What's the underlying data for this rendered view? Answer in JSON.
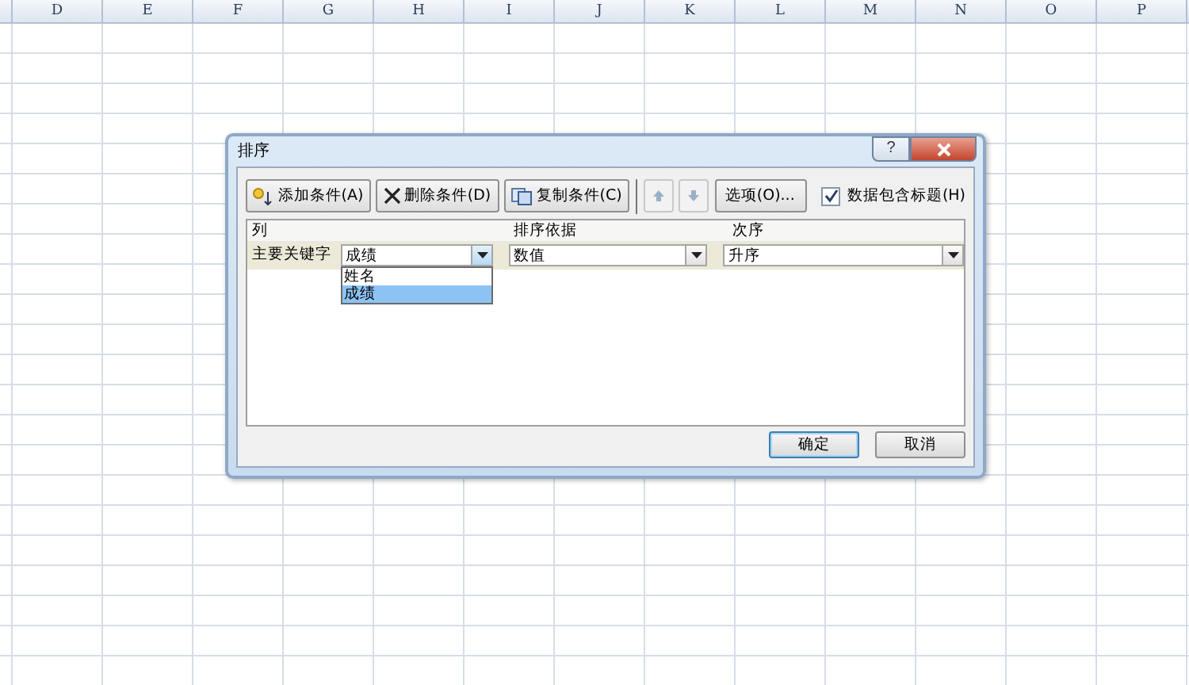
{
  "sheet": {
    "columns": [
      {
        "label": "D"
      },
      {
        "label": "E"
      },
      {
        "label": "F"
      },
      {
        "label": "G"
      },
      {
        "label": "H"
      },
      {
        "label": "I"
      },
      {
        "label": "J"
      },
      {
        "label": "K"
      },
      {
        "label": "L"
      },
      {
        "label": "M"
      },
      {
        "label": "N"
      },
      {
        "label": "O"
      },
      {
        "label": "P"
      }
    ]
  },
  "dialog": {
    "title": "排序",
    "title_buttons": [
      {
        "kind": "help",
        "label": "?"
      },
      {
        "kind": "close"
      }
    ],
    "toolbar": [
      {
        "kind": "add",
        "label": "添加条件(A)",
        "disabled": false
      },
      {
        "kind": "delete",
        "label": "删除条件(D)",
        "disabled": false
      },
      {
        "kind": "copy",
        "label": "复制条件(C)",
        "disabled": false
      },
      {
        "kind": "up",
        "disabled": true
      },
      {
        "kind": "down",
        "disabled": true
      },
      {
        "kind": "text",
        "label": "选项(O)...",
        "disabled": false
      }
    ],
    "header_checkbox": {
      "label": "数据包含标题(H)",
      "checked": true
    },
    "headers": [
      "列",
      "排序依据",
      "次序"
    ],
    "rows": [
      {
        "label": "主要关键字",
        "column": "成绩",
        "sort_on": "数值",
        "order": "升序"
      }
    ],
    "dropdown": {
      "expanded": true,
      "options": [
        {
          "label": "姓名",
          "selected": false
        },
        {
          "label": "成绩",
          "selected": true
        }
      ]
    },
    "buttons": [
      {
        "label": "确定",
        "default": true
      },
      {
        "label": "取消",
        "default": false
      }
    ]
  }
}
